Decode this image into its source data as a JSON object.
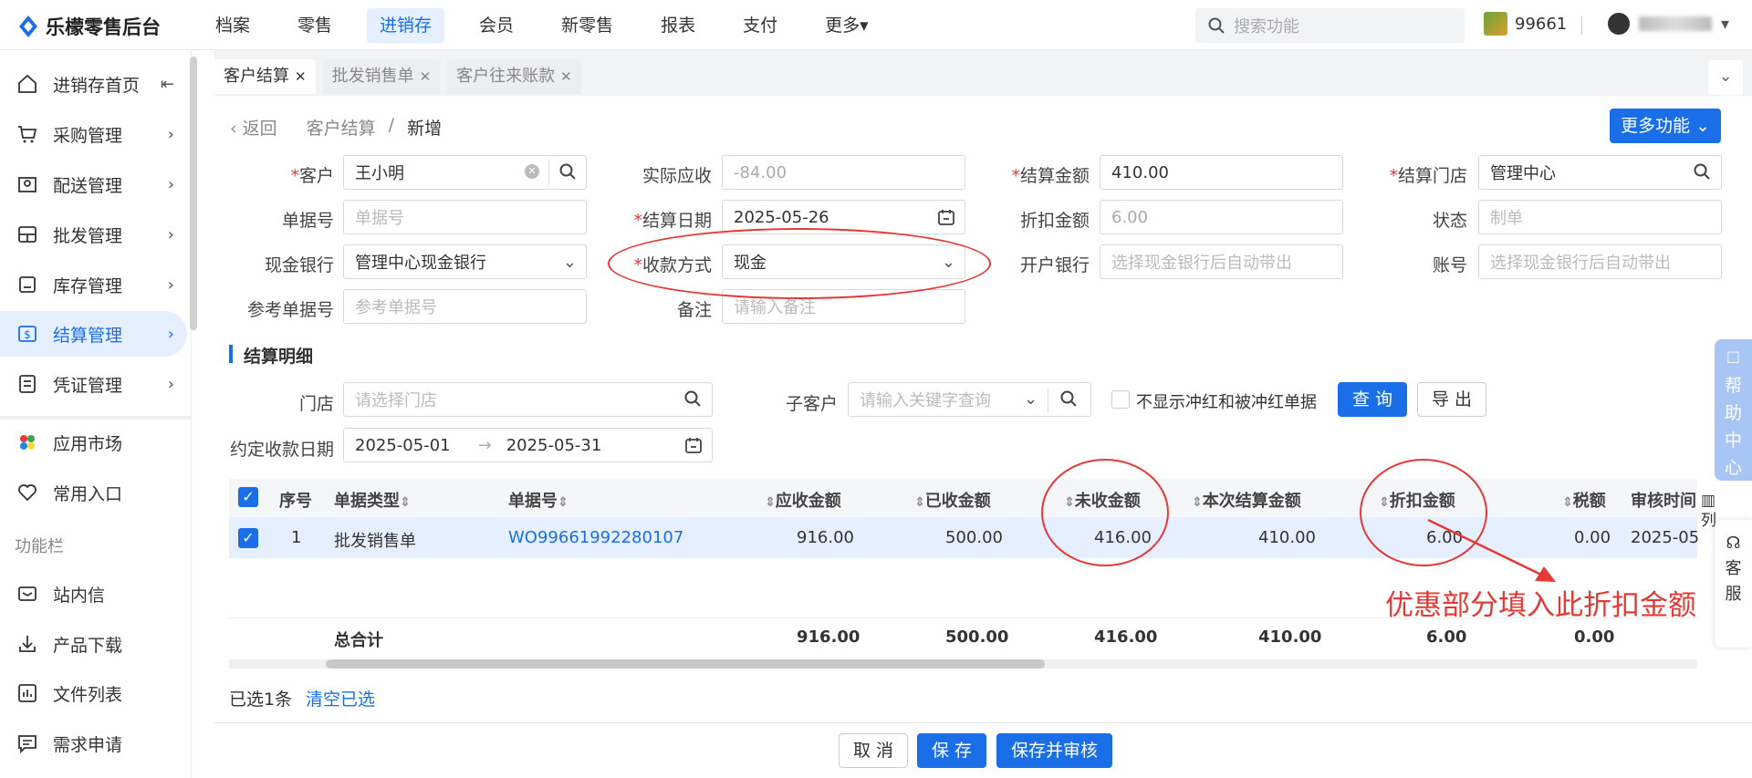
{
  "app": {
    "title": "乐檬零售后台"
  },
  "nav": {
    "items": [
      "档案",
      "零售",
      "进销存",
      "会员",
      "新零售",
      "报表",
      "支付",
      "更多▾"
    ],
    "active_index": 2
  },
  "search": {
    "placeholder": "搜索功能"
  },
  "store": {
    "id": "99661"
  },
  "sidebar": {
    "items": [
      {
        "label": "进销存首页",
        "icon": "home-icon",
        "chev": "⇤"
      },
      {
        "label": "采购管理",
        "icon": "cart-icon",
        "chev": "›"
      },
      {
        "label": "配送管理",
        "icon": "map-icon",
        "chev": "›"
      },
      {
        "label": "批发管理",
        "icon": "board-icon",
        "chev": "›"
      },
      {
        "label": "库存管理",
        "icon": "box-icon",
        "chev": "›"
      },
      {
        "label": "结算管理",
        "icon": "dollar-icon",
        "chev": "›"
      },
      {
        "label": "凭证管理",
        "icon": "doc-icon",
        "chev": "›"
      },
      {
        "label": "应用市场",
        "icon": "apps-icon",
        "chev": ""
      },
      {
        "label": "常用入口",
        "icon": "heart-icon",
        "chev": ""
      }
    ],
    "section_label": "功能栏",
    "section_items": [
      {
        "label": "站内信",
        "icon": "mail-icon"
      },
      {
        "label": "产品下载",
        "icon": "download-icon"
      },
      {
        "label": "文件列表",
        "icon": "chart-icon"
      },
      {
        "label": "需求申请",
        "icon": "comment-icon"
      }
    ]
  },
  "tabs": [
    {
      "label": "客户结算",
      "close": "✕"
    },
    {
      "label": "批发销售单",
      "close": "✕"
    },
    {
      "label": "客户往来账款",
      "close": "✕"
    }
  ],
  "breadcrumb": {
    "back": "返回",
    "parent": "客户结算",
    "sep": "/",
    "current": "新增"
  },
  "more_button": "更多功能",
  "form": {
    "customer": {
      "label": "客户",
      "value": "王小明"
    },
    "actual_receivable": {
      "label": "实际应收",
      "value": "-84.00"
    },
    "settle_amount": {
      "label": "结算金额",
      "value": "410.00"
    },
    "settle_store": {
      "label": "结算门店",
      "value": "管理中心"
    },
    "doc_no": {
      "label": "单据号",
      "placeholder": "单据号"
    },
    "settle_date": {
      "label": "结算日期",
      "value": "2025-05-26"
    },
    "discount": {
      "label": "折扣金额",
      "value": "6.00"
    },
    "status": {
      "label": "状态",
      "placeholder": "制单"
    },
    "cash_bank": {
      "label": "现金银行",
      "value": "管理中心现金银行"
    },
    "pay_method": {
      "label": "收款方式",
      "value": "现金"
    },
    "open_bank": {
      "label": "开户银行",
      "placeholder": "选择现金银行后自动带出"
    },
    "account": {
      "label": "账号",
      "placeholder": "选择现金银行后自动带出"
    },
    "ref_no": {
      "label": "参考单据号",
      "placeholder": "参考单据号"
    },
    "remark": {
      "label": "备注",
      "placeholder": "请输入备注"
    }
  },
  "section_title": "结算明细",
  "filters": {
    "store": {
      "label": "门店",
      "placeholder": "请选择门店"
    },
    "sub_customer": {
      "label": "子客户",
      "placeholder": "请输入关键字查询"
    },
    "hide_red": "不显示冲红和被冲红单据",
    "query": "查 询",
    "export": "导 出",
    "date_label": "约定收款日期",
    "date_from": "2025-05-01",
    "date_arrow": "→",
    "date_to": "2025-05-31"
  },
  "table": {
    "headers": [
      "序号",
      "单据类型",
      "单据号",
      "应收金额",
      "已收金额",
      "未收金额",
      "本次结算金额",
      "折扣金额",
      "税额",
      "审核时间"
    ],
    "rows": [
      {
        "seq": "1",
        "type": "批发销售单",
        "no": "WO99661992280107",
        "receivable": "916.00",
        "received": "500.00",
        "unreceived": "416.00",
        "settle": "410.00",
        "discount": "6.00",
        "tax": "0.00",
        "audit": "2025-05-"
      }
    ],
    "total": {
      "label": "总合计",
      "receivable": "916.00",
      "received": "500.00",
      "unreceived": "416.00",
      "settle": "410.00",
      "discount": "6.00",
      "tax": "0.00"
    },
    "columns_label": "列"
  },
  "selection": {
    "count_text": "已选1条",
    "clear": "清空已选"
  },
  "annotation": {
    "text": "优惠部分填入此折扣金额",
    "color": "#e53935"
  },
  "footer": {
    "cancel": "取 消",
    "save": "保 存",
    "save_audit": "保存并审核"
  },
  "help": {
    "label": "帮助中心",
    "service": "客服"
  },
  "colors": {
    "primary": "#1a6fe8",
    "annotation": "#e53935"
  }
}
